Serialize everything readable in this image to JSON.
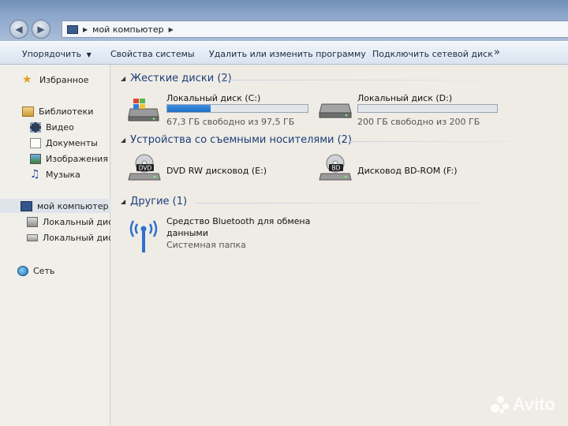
{
  "address": {
    "path_root": "мой компьютер"
  },
  "toolbar": {
    "organize": "Упорядочить",
    "system_properties": "Свойства системы",
    "uninstall": "Удалить или изменить программу",
    "map_drive": "Подключить сетевой диск",
    "more": "»"
  },
  "sidebar": {
    "favorites": "Избранное",
    "libraries": "Библиотеки",
    "video": "Видео",
    "documents": "Документы",
    "images": "Изображения",
    "music": "Музыка",
    "computer": "мой компьютер",
    "local_c": "Локальный дис",
    "local_d": "Локальный дис",
    "network": "Сеть"
  },
  "groups": {
    "hard_disks": {
      "header": "Жесткие диски (2)",
      "drives": [
        {
          "name": "Локальный диск (C:)",
          "free": "67,3 ГБ свободно из 97,5 ГБ",
          "used_fraction": 0.31
        },
        {
          "name": "Локальный диск (D:)",
          "free": "200 ГБ свободно из 200 ГБ",
          "used_fraction": 0.0
        }
      ]
    },
    "removable": {
      "header": "Устройства со съемными носителями (2)",
      "items": [
        {
          "name": "DVD RW дисковод (E:)",
          "badge": "DVD"
        },
        {
          "name": "Дисковод BD-ROM (F:)",
          "badge": "BD"
        }
      ]
    },
    "other": {
      "header": "Другие (1)",
      "item_line1": "Средство Bluetooth для обмена",
      "item_line2": "данными",
      "item_type": "Системная папка"
    }
  },
  "watermark": "Avito",
  "colors": {
    "accent_header": "#1e3d7a",
    "bar_fill": "#2a7fd6"
  }
}
